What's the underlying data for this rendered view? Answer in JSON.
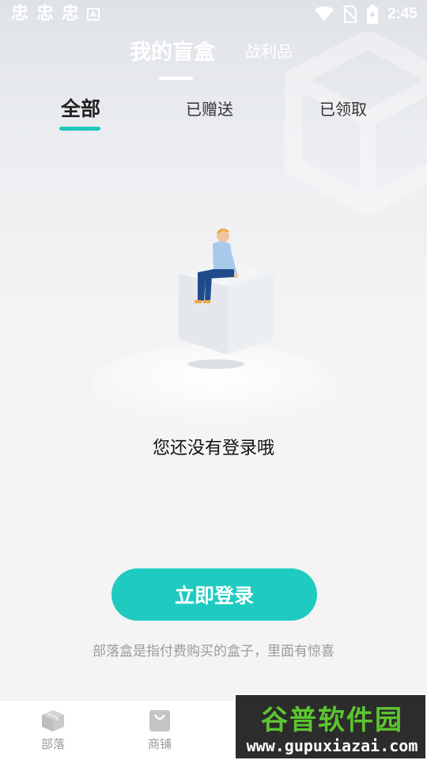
{
  "status_bar": {
    "left_glyphs": [
      "忠",
      "忠",
      "忠"
    ],
    "a_icon": "A",
    "time": "2:45"
  },
  "header": {
    "tab_main": "我的盲盒",
    "tab_second": "战利品"
  },
  "subtabs": [
    {
      "label": "全部",
      "active": true
    },
    {
      "label": "已赠送",
      "active": false
    },
    {
      "label": "已领取",
      "active": false
    }
  ],
  "empty_state": {
    "message": "您还没有登录哦",
    "button_label": "立即登录",
    "hint": "部落盒是指付费购买的盒子，里面有惊喜"
  },
  "bottom_nav": [
    {
      "label": "部落",
      "icon": "box-icon"
    },
    {
      "label": "商铺",
      "icon": "shopping-bag-icon"
    }
  ],
  "watermark": {
    "title": "谷普软件园",
    "url": "www.gupuxiazai.com"
  },
  "colors": {
    "accent": "#1fcbc1",
    "indicator": "#1ec8be",
    "hint": "#9a9a9a"
  }
}
